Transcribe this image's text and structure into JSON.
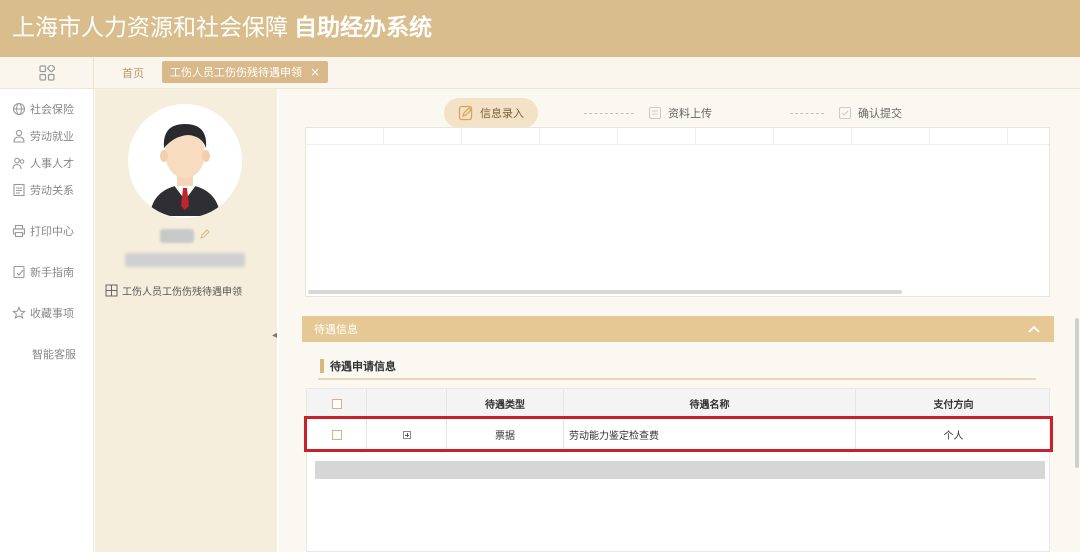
{
  "header": {
    "title_prefix": "上海市人力资源和社会保障",
    "title_bold": "自助经办系统"
  },
  "tabs": {
    "home": "首页",
    "active": "工伤人员工伤伤残待遇申领",
    "close": "×"
  },
  "sidebar": {
    "items": [
      {
        "label": "社会保险",
        "icon": "globe-icon"
      },
      {
        "label": "劳动就业",
        "icon": "worker-icon"
      },
      {
        "label": "人事人才",
        "icon": "people-icon"
      },
      {
        "label": "劳动关系",
        "icon": "document-icon"
      },
      {
        "label": "打印中心",
        "icon": "printer-icon"
      },
      {
        "label": "新手指南",
        "icon": "guide-icon"
      },
      {
        "label": "收藏事项",
        "icon": "star-icon"
      },
      {
        "label": "智能客服",
        "icon": ""
      }
    ]
  },
  "profile": {
    "link_label": "工伤人员工伤伤残待遇申领"
  },
  "steps": [
    {
      "label": "信息录入",
      "active": true
    },
    {
      "label": "资料上传",
      "active": false
    },
    {
      "label": "确认提交",
      "active": false
    }
  ],
  "section": {
    "title": "待遇信息",
    "subtitle": "待遇申请信息"
  },
  "table": {
    "columns": [
      "",
      "",
      "待遇类型",
      "待遇名称",
      "支付方向"
    ],
    "rows": [
      {
        "type": "票据",
        "name": "劳动能力鉴定检查费",
        "direction": "个人"
      }
    ]
  },
  "colors": {
    "header": "#d9bd8d",
    "accent": "#e5c893",
    "highlight": "#c9202a"
  }
}
